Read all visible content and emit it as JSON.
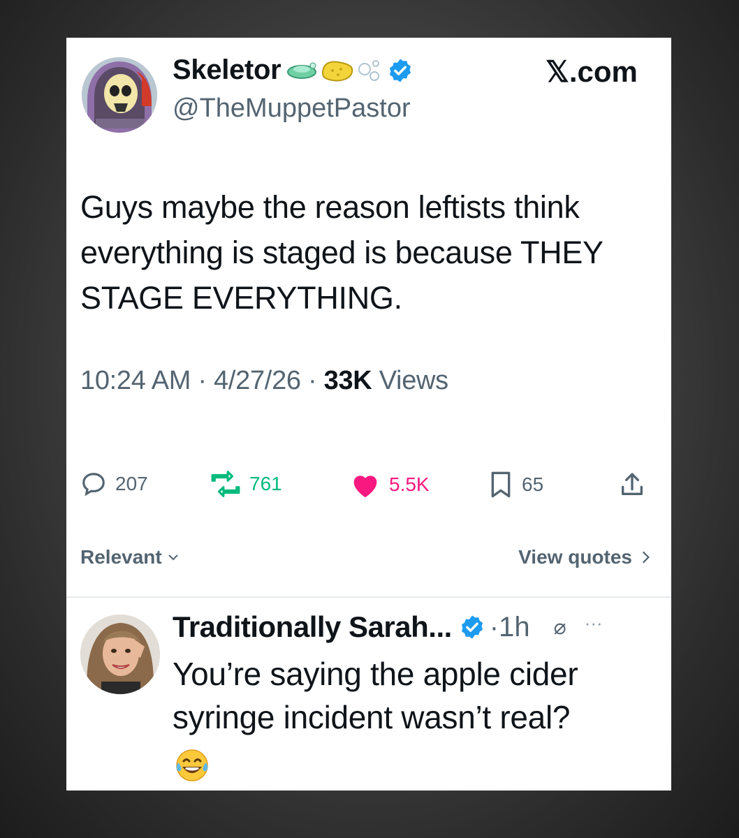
{
  "tweet": {
    "author_name": "Skeletor",
    "handle": "@TheMuppetPastor",
    "brand": "𝕏.com",
    "text": "Guys maybe the reason leftists think everything is staged is because THEY STAGE EVERYTHING.",
    "time": "10:24 AM",
    "date": "4/27/26",
    "views_count": "33K",
    "views_label": "Views",
    "verified_color": "#1d9bf0"
  },
  "actions": {
    "replies": "207",
    "reposts": "761",
    "likes": "5.5K",
    "bookmarks": "65",
    "repost_color": "#00ba7c",
    "like_color": "#f91880"
  },
  "sort": {
    "left_label": "Relevant",
    "right_label": "View quotes"
  },
  "reply": {
    "author_name": "Traditionally Sarah...",
    "time": "1h",
    "text": "You’re saying the apple cider syringe incident wasn’t real?",
    "emoji": "face-with-tears-of-joy"
  }
}
